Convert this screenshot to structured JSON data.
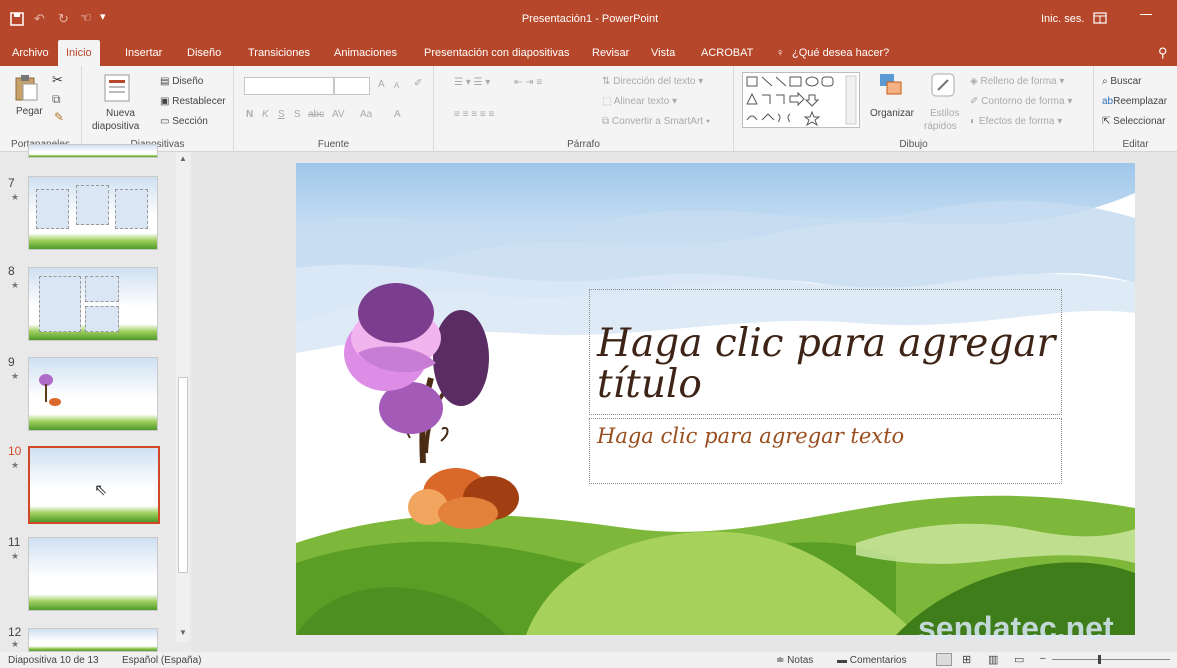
{
  "title_bar": {
    "title": "Presentación1 - PowerPoint",
    "signin": "Inic. ses.",
    "save_icon": "save-icon",
    "undo_icon": "undo-icon",
    "redo_icon": "redo-icon",
    "touch_icon": "touch-mode-icon",
    "layout_icon": "ribbon-display-icon",
    "minimize_icon": "minimize-icon"
  },
  "tabs": [
    "Archivo",
    "Inicio",
    "Insertar",
    "Diseño",
    "Transiciones",
    "Animaciones",
    "Presentación con diapositivas",
    "Revisar",
    "Vista",
    "ACROBAT"
  ],
  "tell_me": "¿Qué desea hacer?",
  "ribbon": {
    "clipboard": {
      "paste": "Pegar",
      "label": "Portapapeles"
    },
    "slides": {
      "new_slide": "Nueva",
      "new_slide2": "diapositiva",
      "layout": "Diseño",
      "reset": "Restablecer",
      "section": "Sección",
      "label": "Diapositivas"
    },
    "font": {
      "bold": "N",
      "italic": "K",
      "underline": "S",
      "shadow": "S",
      "strike": "abc",
      "spacing": "AV",
      "case": "Aa",
      "color": "A",
      "grow": "A",
      "shrink": "A",
      "label": "Fuente"
    },
    "paragraph": {
      "direction": "Dirección del texto",
      "align": "Alinear texto",
      "smartart": "Convertir a SmartArt",
      "label": "Párrafo"
    },
    "drawing": {
      "arrange": "Organizar",
      "styles1": "Estilos",
      "styles2": "rápidos",
      "fill": "Relleno de forma",
      "outline": "Contorno de forma",
      "effects": "Efectos de forma",
      "label": "Dibujo"
    },
    "editing": {
      "find": "Buscar",
      "replace": "Reemplazar",
      "select": "Seleccionar",
      "label": "Editar"
    }
  },
  "slides_panel": [
    {
      "number": "7",
      "star": "★"
    },
    {
      "number": "8",
      "star": "★"
    },
    {
      "number": "9",
      "star": "★"
    },
    {
      "number": "10",
      "star": "★"
    },
    {
      "number": "11",
      "star": "★"
    },
    {
      "number": "12",
      "star": "★"
    }
  ],
  "slide": {
    "title_placeholder_line1": "Haga clic para agregar",
    "title_placeholder_line2": "título",
    "text_placeholder": "Haga clic para agregar texto"
  },
  "watermark": "sendatec.net",
  "status": {
    "slide_info": "Diapositiva 10 de 13",
    "language": "Español (España)",
    "notes": "Notas",
    "comments": "Comentarios"
  }
}
